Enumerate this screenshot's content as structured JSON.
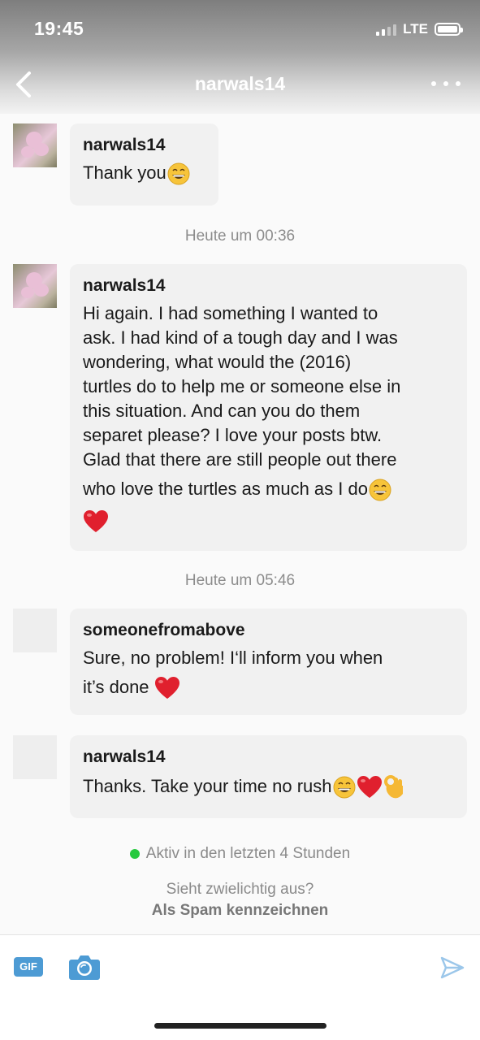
{
  "status_bar": {
    "time": "19:45",
    "network": "LTE",
    "signal_bars": 4,
    "signal_bars_filled": 2
  },
  "header": {
    "title": "narwals14"
  },
  "conversation": {
    "messages": [
      {
        "sender": "narwals14",
        "text": "Thank you",
        "emoji": [
          "grinning-face"
        ]
      },
      {
        "sender": "narwals14",
        "text_lines": [
          "Hi again. I had something I wanted to",
          "ask. I had kind of a tough day and I was",
          "wondering, what would the (2016)",
          "turtles do to help me or someone else in",
          "this situation. And can you do them",
          "separet please? I love your posts btw.",
          "Glad that there are still people out there",
          "who love the turtles as much as I do"
        ],
        "emoji": [
          "grinning-face",
          "red-heart"
        ]
      },
      {
        "sender": "someonefromabove",
        "text_lines": [
          "Sure, no problem! I‘ll inform you when",
          "it’s done"
        ],
        "emoji": [
          "red-heart"
        ]
      },
      {
        "sender": "narwals14",
        "text": "Thanks. Take your time no rush",
        "emoji": [
          "grinning-face",
          "red-heart",
          "ok-hand"
        ]
      }
    ],
    "timestamps": [
      "Heute um 00:36",
      "Heute um 05:46"
    ]
  },
  "footer": {
    "active_status": "Aktiv in den letzten 4 Stunden",
    "suspicious_prompt": "Sieht zwielichtig aus?",
    "spam_link": "Als Spam kennzeichnen"
  },
  "toolbar": {
    "gif_label": "GIF"
  },
  "colors": {
    "accent_blue": "#4d9bd4",
    "active_green": "#27c93f",
    "bubble_bg": "#f1f1f1",
    "heart_red": "#e0202e"
  }
}
